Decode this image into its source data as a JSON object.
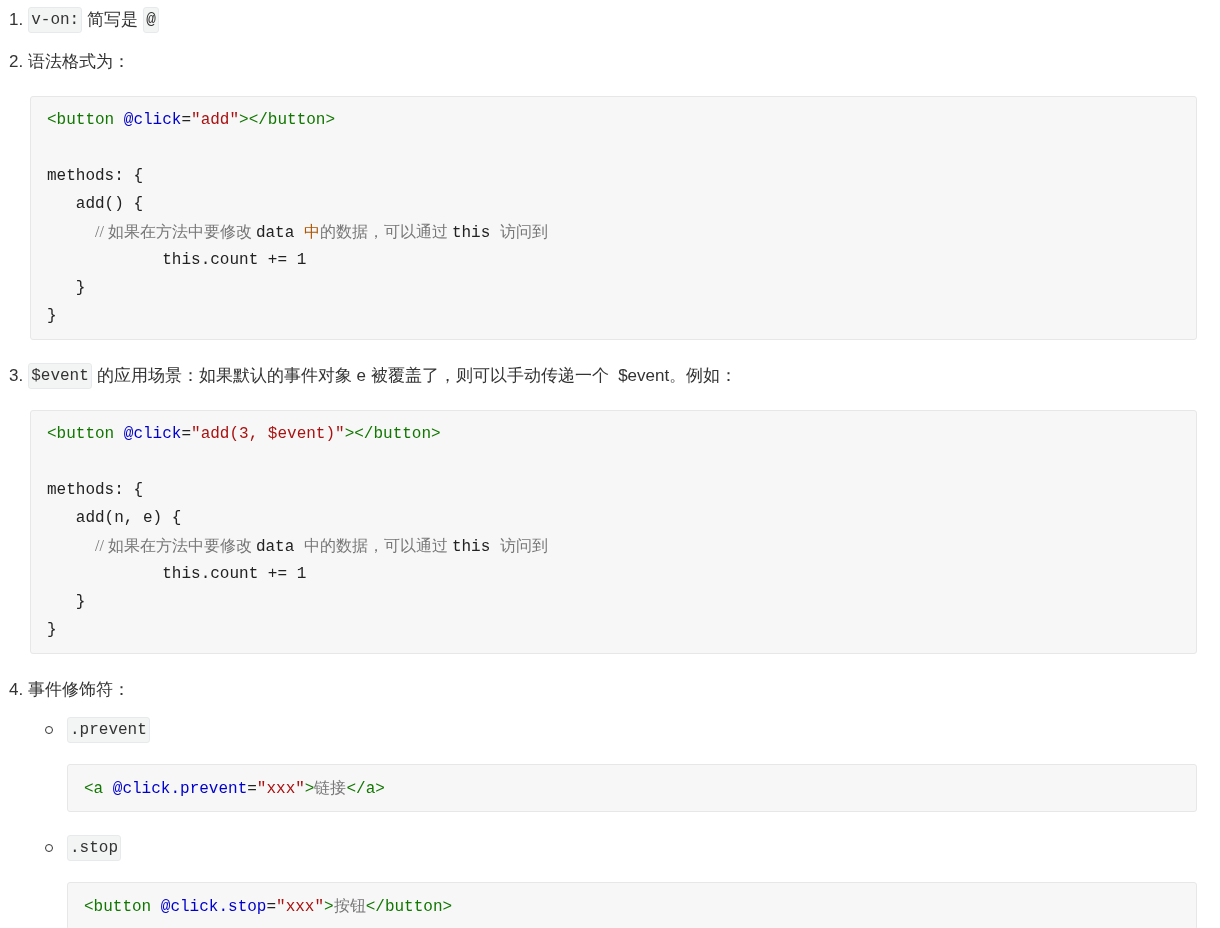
{
  "items": [
    {
      "number": "1.",
      "parts": [
        {
          "kind": "code",
          "text": "v-on:"
        },
        {
          "kind": "text",
          "text": "简写是"
        },
        {
          "kind": "code",
          "text": "@"
        }
      ]
    },
    {
      "number": "2.",
      "parts": [
        {
          "kind": "text",
          "text": "语法格式为："
        }
      ],
      "blocks": [
        {
          "lines": [
            {
              "tokens": [
                {
                  "kind": "tag",
                  "text": "<button "
                },
                {
                  "kind": "attr",
                  "text": "@click"
                },
                {
                  "kind": "plain",
                  "text": "="
                },
                {
                  "kind": "string",
                  "text": "\"add\""
                },
                {
                  "kind": "tag",
                  "text": "></button>"
                }
              ]
            },
            {
              "kind": "blank"
            },
            {
              "tokens": [
                {
                  "kind": "plain",
                  "text": "methods: {"
                }
              ]
            },
            {
              "tokens": [
                {
                  "kind": "plain",
                  "text": "   add() {"
                }
              ]
            },
            {
              "tokens": [
                {
                  "kind": "comment",
                  "text": "            // 如果在方法中要修改 "
                },
                {
                  "kind": "plain",
                  "text": "data "
                },
                {
                  "kind": "keyword",
                  "text": "中"
                },
                {
                  "kind": "comment",
                  "text": "的数据，可以通过 "
                },
                {
                  "kind": "plain",
                  "text": "this "
                },
                {
                  "kind": "comment",
                  "text": "访问到"
                }
              ]
            },
            {
              "tokens": [
                {
                  "kind": "plain",
                  "text": "            this.count += 1"
                }
              ]
            },
            {
              "tokens": [
                {
                  "kind": "plain",
                  "text": "   }"
                }
              ]
            },
            {
              "tokens": [
                {
                  "kind": "plain",
                  "text": "}"
                }
              ]
            }
          ]
        }
      ]
    },
    {
      "number": "3.",
      "parts": [
        {
          "kind": "code",
          "text": "$event"
        },
        {
          "kind": "text",
          "text": "的应用场景：如果默认的事件对象 e 被覆盖了，则可以手动传递一个  $event。例如："
        }
      ],
      "blocks": [
        {
          "lines": [
            {
              "tokens": [
                {
                  "kind": "tag",
                  "text": "<button "
                },
                {
                  "kind": "attr",
                  "text": "@click"
                },
                {
                  "kind": "plain",
                  "text": "="
                },
                {
                  "kind": "string",
                  "text": "\"add(3, $event)\""
                },
                {
                  "kind": "tag",
                  "text": "></button>"
                }
              ]
            },
            {
              "kind": "blank"
            },
            {
              "tokens": [
                {
                  "kind": "plain",
                  "text": "methods: {"
                }
              ]
            },
            {
              "tokens": [
                {
                  "kind": "plain",
                  "text": "   add(n, e) {"
                }
              ]
            },
            {
              "tokens": [
                {
                  "kind": "comment",
                  "text": "            // 如果在方法中要修改 "
                },
                {
                  "kind": "plain",
                  "text": "data "
                },
                {
                  "kind": "comment",
                  "text": "中的数据，可以通过 "
                },
                {
                  "kind": "plain",
                  "text": "this "
                },
                {
                  "kind": "comment",
                  "text": "访问到"
                }
              ]
            },
            {
              "tokens": [
                {
                  "kind": "plain",
                  "text": "            this.count += 1"
                }
              ]
            },
            {
              "tokens": [
                {
                  "kind": "plain",
                  "text": "   }"
                }
              ]
            },
            {
              "tokens": [
                {
                  "kind": "plain",
                  "text": "}"
                }
              ]
            }
          ]
        }
      ]
    },
    {
      "number": "4.",
      "parts": [
        {
          "kind": "text",
          "text": "事件修饰符："
        }
      ],
      "subitems": [
        {
          "code": ".prevent",
          "blocks": [
            {
              "lines": [
                {
                  "tokens": [
                    {
                      "kind": "tag",
                      "text": "<a "
                    },
                    {
                      "kind": "attr",
                      "text": "@click.prevent"
                    },
                    {
                      "kind": "plain",
                      "text": "="
                    },
                    {
                      "kind": "string",
                      "text": "\"xxx\""
                    },
                    {
                      "kind": "tag",
                      "text": ">"
                    },
                    {
                      "kind": "comment",
                      "text": "链接"
                    },
                    {
                      "kind": "tag",
                      "text": "</a>"
                    }
                  ]
                }
              ]
            }
          ]
        },
        {
          "code": ".stop",
          "blocks": [
            {
              "lines": [
                {
                  "tokens": [
                    {
                      "kind": "tag",
                      "text": "<button "
                    },
                    {
                      "kind": "attr",
                      "text": "@click.stop"
                    },
                    {
                      "kind": "plain",
                      "text": "="
                    },
                    {
                      "kind": "string",
                      "text": "\"xxx\""
                    },
                    {
                      "kind": "tag",
                      "text": ">"
                    },
                    {
                      "kind": "comment",
                      "text": "按钮"
                    },
                    {
                      "kind": "tag",
                      "text": "</button>"
                    }
                  ]
                }
              ]
            }
          ]
        }
      ]
    }
  ]
}
